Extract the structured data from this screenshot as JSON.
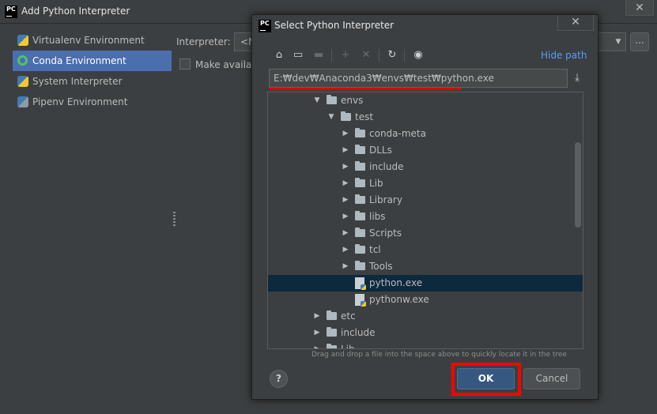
{
  "outer_window": {
    "title": "Add Python Interpreter",
    "close_glyph": "✕",
    "environments": [
      {
        "label": "Virtualenv Environment",
        "icon": "python-icon",
        "selected": false
      },
      {
        "label": "Conda Environment",
        "icon": "conda-icon",
        "selected": true
      },
      {
        "label": "System Interpreter",
        "icon": "python-icon",
        "selected": false
      },
      {
        "label": "Pipenv Environment",
        "icon": "pipenv-icon",
        "selected": false
      }
    ],
    "interpreter_label": "Interpreter:",
    "interpreter_value": "<N",
    "browse_label": "...",
    "make_available_label": "Make availab"
  },
  "dialog": {
    "title": "Select Python Interpreter",
    "close_glyph": "✕",
    "hide_path_label": "Hide path",
    "path_value": "E:₩dev₩Anaconda3₩envs₩test₩python.exe",
    "tree": [
      {
        "label": "envs",
        "type": "folder",
        "depth": 0,
        "expanded": true,
        "selected": false
      },
      {
        "label": "test",
        "type": "folder",
        "depth": 1,
        "expanded": true,
        "selected": false
      },
      {
        "label": "conda-meta",
        "type": "folder",
        "depth": 2,
        "expanded": false,
        "selected": false
      },
      {
        "label": "DLLs",
        "type": "folder",
        "depth": 2,
        "expanded": false,
        "selected": false
      },
      {
        "label": "include",
        "type": "folder",
        "depth": 2,
        "expanded": false,
        "selected": false
      },
      {
        "label": "Lib",
        "type": "folder",
        "depth": 2,
        "expanded": false,
        "selected": false
      },
      {
        "label": "Library",
        "type": "folder",
        "depth": 2,
        "expanded": false,
        "selected": false
      },
      {
        "label": "libs",
        "type": "folder",
        "depth": 2,
        "expanded": false,
        "selected": false
      },
      {
        "label": "Scripts",
        "type": "folder",
        "depth": 2,
        "expanded": false,
        "selected": false
      },
      {
        "label": "tcl",
        "type": "folder",
        "depth": 2,
        "expanded": false,
        "selected": false
      },
      {
        "label": "Tools",
        "type": "folder",
        "depth": 2,
        "expanded": false,
        "selected": false
      },
      {
        "label": "python.exe",
        "type": "file",
        "depth": 2,
        "expanded": false,
        "selected": true
      },
      {
        "label": "pythonw.exe",
        "type": "file",
        "depth": 2,
        "expanded": false,
        "selected": false
      },
      {
        "label": "etc",
        "type": "folder",
        "depth": 0,
        "expanded": false,
        "selected": false
      },
      {
        "label": "include",
        "type": "folder",
        "depth": 0,
        "expanded": false,
        "selected": false
      },
      {
        "label": "Lib",
        "type": "folder",
        "depth": 0,
        "expanded": false,
        "selected": false
      }
    ],
    "drag_hint": "Drag and drop a file into the space above to quickly locate it in the tree",
    "help_label": "?",
    "ok_label": "OK",
    "cancel_label": "Cancel"
  },
  "colors": {
    "background": "#3c3f41",
    "selection": "#4b6eaf",
    "tree_selection": "#0d293e",
    "link": "#589df6",
    "highlight_red": "#ff0000",
    "ok_button": "#365880"
  }
}
